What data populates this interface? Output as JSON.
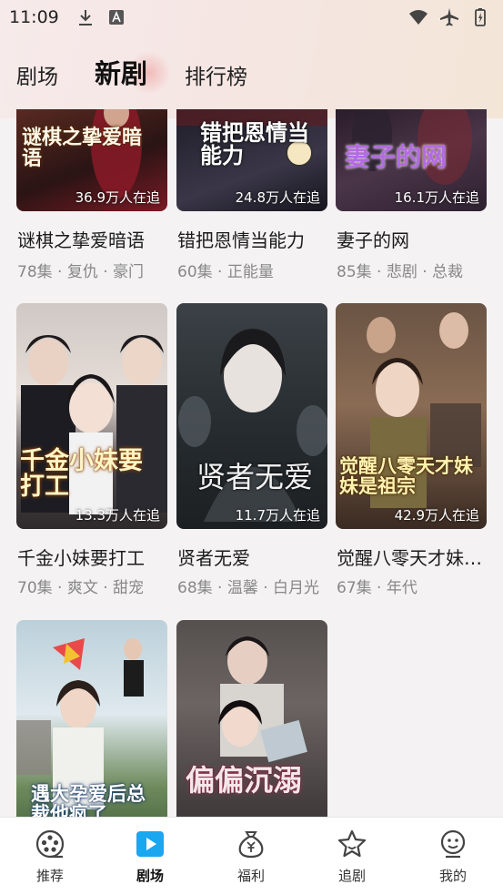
{
  "status_bar": {
    "time": "11:09"
  },
  "tabs": [
    {
      "label": "剧场",
      "active": false
    },
    {
      "label": "新剧",
      "active": true
    },
    {
      "label": "排行榜",
      "active": false
    }
  ],
  "dramas": [
    {
      "title": "谜棋之挚爱暗语",
      "poster_title": "谜棋之挚爱暗语",
      "viewers": "36.9万人在追",
      "episodes": "78集",
      "tags": "复仇 · 豪门",
      "meta": "78集 · 复仇 · 豪门",
      "color": "#3a1c1c"
    },
    {
      "title": "错把恩情当能力",
      "poster_title": "错把恩情当能力",
      "viewers": "24.8万人在追",
      "episodes": "60集",
      "tags": "正能量",
      "meta": "60集 · 正能量",
      "color": "#2b2a36"
    },
    {
      "title": "妻子的网",
      "poster_title": "妻子的网",
      "viewers": "16.1万人在追",
      "episodes": "85集",
      "tags": "悲剧 · 总裁",
      "meta": "85集 · 悲剧 · 总裁",
      "color": "#3d2b3a"
    },
    {
      "title": "千金小妹要打工",
      "poster_title": "千金小妹要打工",
      "viewers": "13.3万人在追",
      "episodes": "70集",
      "tags": "爽文 · 甜宠",
      "meta": "70集 · 爽文 · 甜宠",
      "color": "#6a5a55"
    },
    {
      "title": "贤者无爱",
      "poster_title": "贤者无爱",
      "viewers": "11.7万人在追",
      "episodes": "68集",
      "tags": "温馨 · 白月光",
      "meta": "68集 · 温馨 · 白月光",
      "color": "#2d3236"
    },
    {
      "title": "觉醒八零天才妹…",
      "poster_title": "觉醒八零天才妹妹是祖宗",
      "viewers": "42.9万人在追",
      "episodes": "67集",
      "tags": "年代",
      "meta": "67集 · 年代",
      "color": "#5a4638"
    },
    {
      "title": "",
      "poster_title": "遇大孕爱后总裁他疯了",
      "viewers": "",
      "episodes": "",
      "tags": "",
      "meta": "",
      "color": "#8fa2a8"
    },
    {
      "title": "",
      "poster_title": "偏偏沉溺",
      "viewers": "",
      "episodes": "",
      "tags": "",
      "meta": "",
      "color": "#4a4246"
    }
  ],
  "bottom_nav": [
    {
      "label": "推荐",
      "icon": "film-reel-icon",
      "active": false
    },
    {
      "label": "剧场",
      "icon": "play-icon",
      "active": true
    },
    {
      "label": "福利",
      "icon": "money-bag-icon",
      "active": false
    },
    {
      "label": "追剧",
      "icon": "star-icon",
      "active": false
    },
    {
      "label": "我的",
      "icon": "profile-icon",
      "active": false
    }
  ],
  "colors": {
    "accent": "#1aa7f0",
    "nav_icon": "#444444"
  }
}
